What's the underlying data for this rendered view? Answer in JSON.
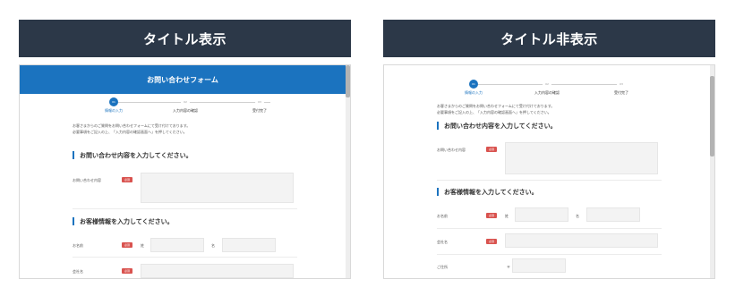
{
  "panels": {
    "left": {
      "title": "タイトル表示"
    },
    "right": {
      "title": "タイトル非表示"
    }
  },
  "form": {
    "header_title": "お問い合わせフォーム",
    "steps": [
      {
        "num": "01",
        "label": "情報の入力"
      },
      {
        "num": "02",
        "label": "入力内容の確認"
      },
      {
        "num": "03",
        "label": "受付完了"
      }
    ],
    "intro": [
      "お客さまからのご質問をお問い合わせフォームにて受け付けております。",
      "必要事項をご記入の上、「入力内容の確認画面へ」を押してください。"
    ],
    "section_inquiry": "お問い合わせ内容を入力してください。",
    "section_customer": "お客様情報を入力してください。",
    "field_inquiry": "お問い合わせ内容",
    "field_name": "お名前",
    "field_company": "会社名",
    "field_address": "ご住所",
    "required": "必須",
    "last_name": "姓",
    "first_name": "名",
    "postal_mark": "〒"
  }
}
